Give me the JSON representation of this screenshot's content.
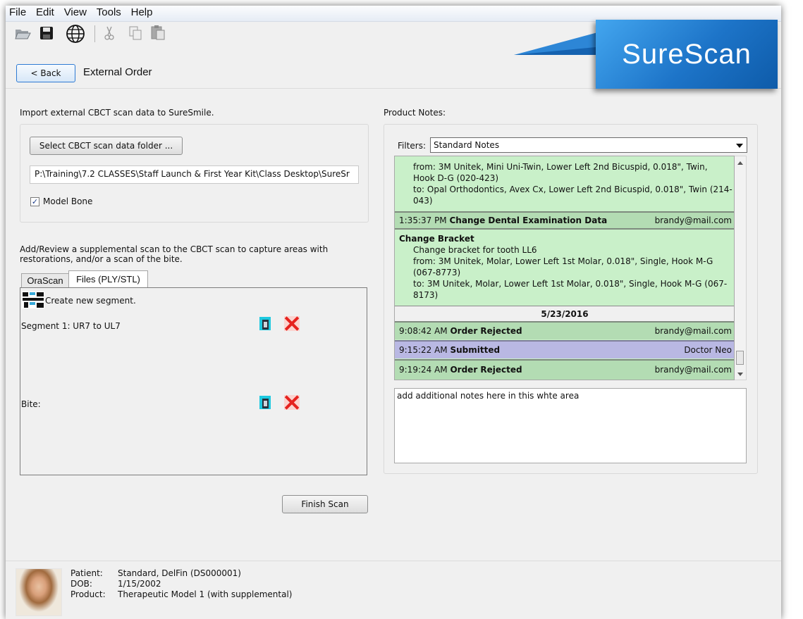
{
  "menu": [
    "File",
    "Edit",
    "View",
    "Tools",
    "Help"
  ],
  "toolbar": {
    "icons": [
      "open-folder-icon",
      "save-icon",
      "globe-icon",
      "cut-icon",
      "copy-icon",
      "paste-icon"
    ]
  },
  "header": {
    "back_label": "< Back",
    "title": "External Order"
  },
  "brand": {
    "text": "SureScan",
    "color": "#1d74c8"
  },
  "left": {
    "import_label": "Import external CBCT scan data to SureSmile.",
    "select_folder_label": "Select CBCT scan data folder ...",
    "folder_path": "P:\\Training\\7.2 CLASSES\\Staff Launch & First Year Kit\\Class Desktop\\SureSr",
    "model_bone_label": "Model Bone",
    "model_bone_checked": true,
    "supplemental_text_1": "Add/Review a supplemental scan to the CBCT scan to capture areas with",
    "supplemental_text_2": "restorations, and/or a scan of the bite.",
    "tabs": [
      "OraScan",
      "Files (PLY/STL)"
    ],
    "active_tab": "Files (PLY/STL)",
    "create_segment_label": "Create new segment.",
    "segment_1_label": "Segment 1: UR7 to UL7",
    "bite_label": "Bite:",
    "finish_label": "Finish Scan"
  },
  "right": {
    "product_notes_label": "Product Notes:",
    "filters_label": "Filters:",
    "filter_value": "Standard Notes",
    "note_top": {
      "from": "from: 3M Unitek, Mini Uni-Twin, Lower Left 2nd Bicuspid, 0.018\", Twin,",
      "from_2": "Hook D-G (020-423)",
      "to": "to: Opal Orthodontics, Avex Cx, Lower Left 2nd Bicuspid, 0.018\", Twin (214-",
      "to_2": "043)"
    },
    "row_exam": {
      "time": "1:35:37 PM",
      "title": "Change Dental Examination Data",
      "who": "brandy@mail.com"
    },
    "note_bracket": {
      "title": "Change Bracket",
      "line1": "Change bracket for tooth LL6",
      "line2": "from: 3M Unitek, Molar, Lower Left 1st Molar, 0.018\", Single, Hook M-G",
      "line3": "(067-8773)",
      "line4": "to: 3M Unitek, Molar, Lower Left 1st Molar, 0.018\", Single, Hook M-G (067-",
      "line5": "8173)"
    },
    "date_header": "5/23/2016",
    "row_rejected_1": {
      "time": "9:08:42 AM",
      "title": "Order Rejected",
      "who": "brandy@mail.com"
    },
    "row_submitted": {
      "time": "9:15:22 AM",
      "title": "Submitted",
      "who": "Doctor Neo"
    },
    "row_rejected_2": {
      "time": "9:19:24 AM",
      "title": "Order Rejected",
      "who": "brandy@mail.com"
    },
    "additional_notes": "add additional notes here in this whte area",
    "colors": {
      "note_green": "#c9f0c9",
      "row_green": "#b3dcb3",
      "row_purple": "#b9b8e3"
    }
  },
  "patient": {
    "patient_label": "Patient:",
    "patient_value": "Standard, DelFin (DS000001)",
    "dob_label": "DOB:",
    "dob_value": "1/15/2002",
    "product_label": "Product:",
    "product_value": "Therapeutic Model 1 (with supplemental)"
  }
}
